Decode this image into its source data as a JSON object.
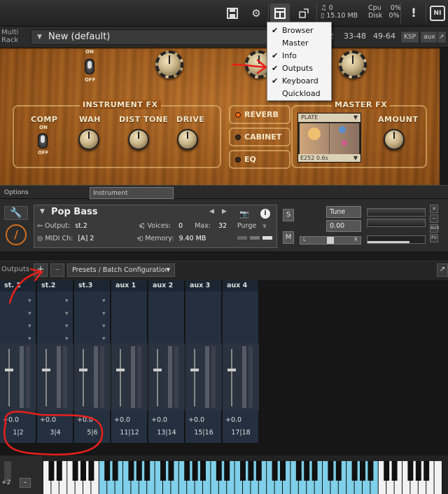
{
  "topbar": {
    "save_icon": "save-icon",
    "gear_icon": "gear-icon",
    "view_icon": "view-icon",
    "minimize_icon": "resize-icon",
    "stats": {
      "voices": "0",
      "memory": "15.10 MB",
      "cpu_label": "Cpu",
      "cpu_value": "0%",
      "disk_label": "Disk",
      "disk_value": "0%"
    },
    "alert": "!",
    "logo": "NI"
  },
  "view_menu": {
    "items": [
      {
        "label": "Browser",
        "checked": true
      },
      {
        "label": "Master",
        "checked": false
      },
      {
        "label": "Info",
        "checked": true
      },
      {
        "label": "Outputs",
        "checked": true
      },
      {
        "label": "Keyboard",
        "checked": true
      },
      {
        "label": "Quickload",
        "checked": false
      }
    ]
  },
  "rack": {
    "label_line1": "Multi",
    "label_line2": "Rack",
    "name": "New (default)",
    "tabs": [
      "2",
      "33-48",
      "49-64"
    ],
    "ksp": "KSP",
    "aux": "aux"
  },
  "instrument_panel": {
    "on_label": "ON",
    "off_label": "OFF",
    "instrument_fx": "INSTRUMENT FX",
    "master_fx": "MASTER FX",
    "comp": "COMP",
    "comp_on": "ON",
    "comp_off": "OFF",
    "wah": "WAH",
    "dist_tone": "DIST TONE",
    "drive": "DRIVE",
    "reverb": "REVERB",
    "cabinet": "CABINET",
    "eq": "EQ",
    "plate": "PLATE",
    "plate_footer": "E252 0.6s",
    "amount": "AMOUNT"
  },
  "options_strip": {
    "options": "Options",
    "instrument": "Instrument"
  },
  "instrument_header": {
    "name": "Pop Bass",
    "output_label": "Output:",
    "output_value": "st.2",
    "voices_label": "Voices:",
    "voices_value": "0",
    "max_label": "Max:",
    "max_value": "32",
    "purge": "Purge",
    "midi_label": "MIDI Ch:",
    "midi_value": "[A]  2",
    "memory_label": "Memory:",
    "memory_value": "9.40 MB",
    "s_button": "S",
    "m_button": "M",
    "tune_label": "Tune",
    "tune_value": "0.00",
    "pan_left": "L",
    "pan_right": "R",
    "aux_label": "AUX",
    "pv_label": "PV"
  },
  "outputs": {
    "label": "Outputs",
    "add": "+",
    "remove": "–",
    "presets": "Presets / Batch Configuration",
    "channels": [
      {
        "name": "st. 1",
        "gain": "+0.0",
        "out": "1|2"
      },
      {
        "name": "st.2",
        "gain": "+0.0",
        "out": "3|4"
      },
      {
        "name": "st.3",
        "gain": "+0.0",
        "out": "5|6"
      },
      {
        "name": "aux 1",
        "gain": "+0.0",
        "out": "11|12"
      },
      {
        "name": "aux 2",
        "gain": "+0.0",
        "out": "13|14"
      },
      {
        "name": "aux 3",
        "gain": "+0.0",
        "out": "15|16"
      },
      {
        "name": "aux 4",
        "gain": "+0.0",
        "out": "17|18"
      }
    ]
  },
  "keyboard": {
    "octave": "+2",
    "minus": "–"
  },
  "colors": {
    "accent_red": "#e8201a",
    "key_highlight": "#7fd0e8",
    "led_on": "#ff6a10"
  }
}
